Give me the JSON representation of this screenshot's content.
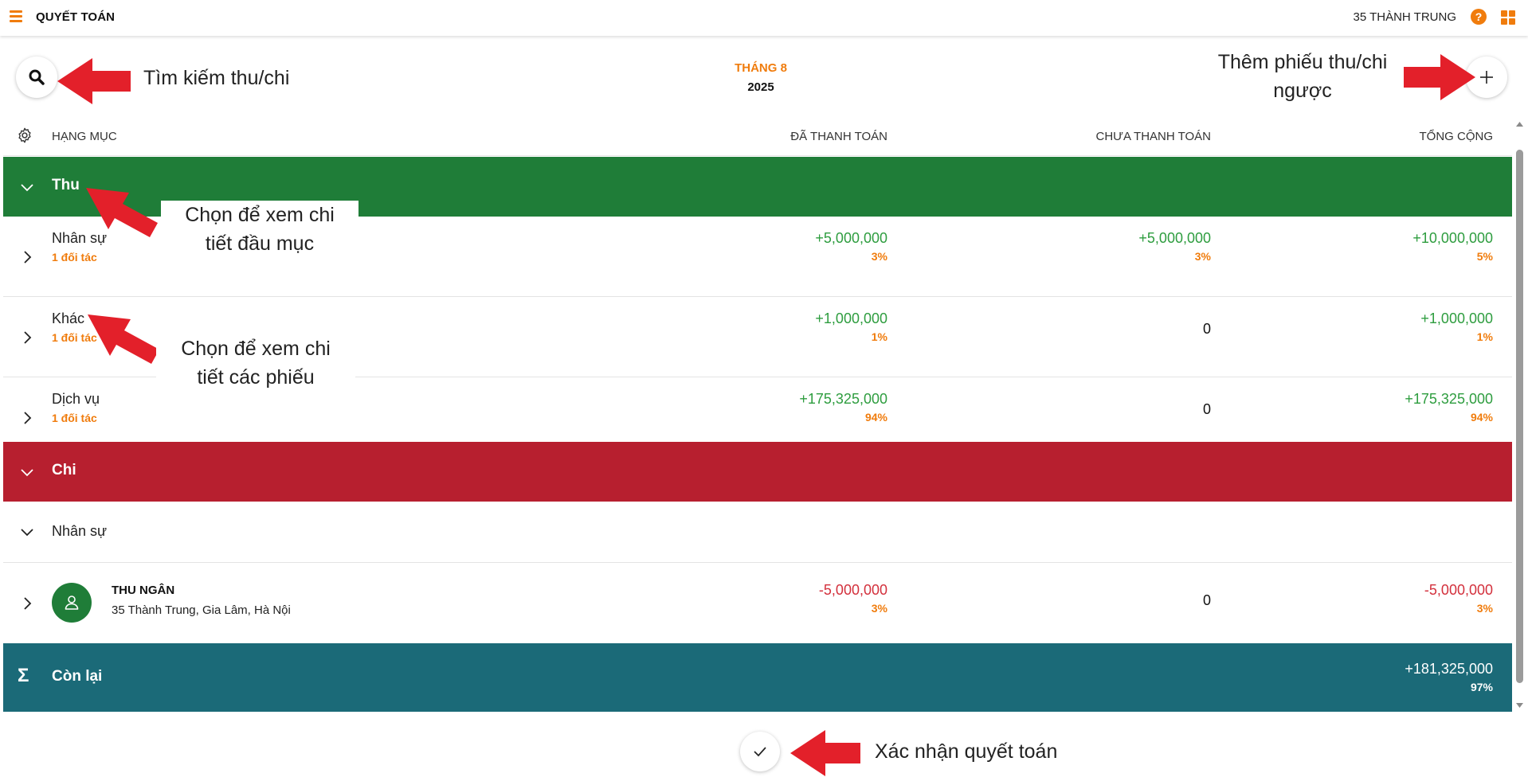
{
  "app": {
    "title": "QUYẾT TOÁN",
    "user": "35 THÀNH TRUNG",
    "help_symbol": "?"
  },
  "colors": {
    "accent": "#f07c0d",
    "income": "#1f7d38",
    "expense": "#b71f2f",
    "balance": "#1b6a78",
    "positive": "#2e9d3f",
    "negative": "#d3303c",
    "annotation_arrow": "#e3202a"
  },
  "icons": {
    "menu": "hamburger-icon",
    "help": "question-circle-icon",
    "apps": "grid-icon",
    "search": "magnifier-icon",
    "add": "plus-icon",
    "settings": "gear-icon",
    "collapse": "chevron-down-icon",
    "expand": "chevron-right-icon",
    "user": "person-icon",
    "sum": "sigma-icon",
    "confirm": "check-icon"
  },
  "period": {
    "month": "THÁNG 8",
    "year": "2025"
  },
  "columns": {
    "category": "HẠNG MỤC",
    "paid": "ĐÃ THANH TOÁN",
    "unpaid": "CHƯA THANH TOÁN",
    "total": "TỔNG CỘNG"
  },
  "income": {
    "title": "Thu",
    "items": [
      {
        "label": "Nhân sự",
        "sub": "1 đối tác",
        "paid": "+5,000,000",
        "paid_pct": "3%",
        "unpaid": "+5,000,000",
        "unpaid_pct": "3%",
        "total": "+10,000,000",
        "total_pct": "5%"
      },
      {
        "label": "Khác",
        "sub": "1 đối tác",
        "paid": "+1,000,000",
        "paid_pct": "1%",
        "unpaid": "0",
        "total": "+1,000,000",
        "total_pct": "1%"
      },
      {
        "label": "Dịch vụ",
        "sub": "1 đối tác",
        "paid": "+175,325,000",
        "paid_pct": "94%",
        "unpaid": "0",
        "total": "+175,325,000",
        "total_pct": "94%"
      }
    ]
  },
  "expense": {
    "title": "Chi",
    "group": "Nhân sự",
    "employee": {
      "name": "THU NGÂN",
      "address": "35 Thành Trung, Gia Lâm, Hà Nội",
      "paid": "-5,000,000",
      "paid_pct": "3%",
      "unpaid": "0",
      "total": "-5,000,000",
      "total_pct": "3%"
    }
  },
  "balance": {
    "title": "Còn lại",
    "symbol": "Σ",
    "total": "+181,325,000",
    "total_pct": "97%"
  },
  "annotations": {
    "search": "Tìm kiếm thu/chi",
    "add": [
      "Thêm phiếu thu/chi",
      "ngược"
    ],
    "section": [
      "Chọn để xem chi",
      "tiết đầu mục"
    ],
    "item": [
      "Chọn để xem chi",
      "tiết các phiếu"
    ],
    "confirm": "Xác nhận quyết toán"
  }
}
